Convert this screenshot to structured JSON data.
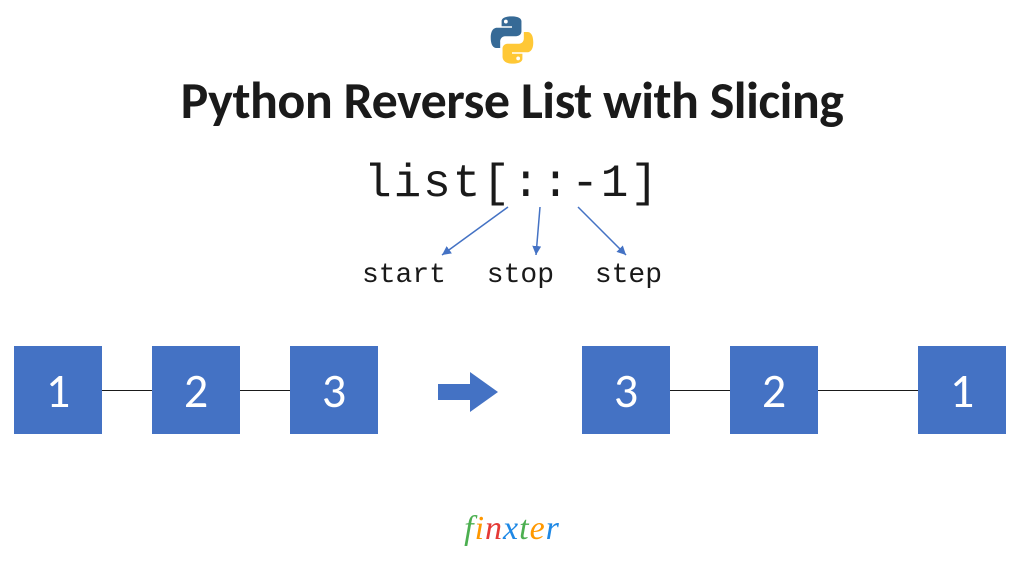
{
  "title": "Python Reverse List with Slicing",
  "code_expression": "list[::-1]",
  "slice_labels": {
    "start": "start",
    "stop": "stop",
    "step": "step"
  },
  "lists": {
    "original": [
      "1",
      "2",
      "3"
    ],
    "reversed": [
      "3",
      "2",
      "1"
    ]
  },
  "colors": {
    "node_fill": "#4472c4",
    "arrow_fill": "#4472c4",
    "annotation_arrow": "#4472c4",
    "text": "#1a1a1a"
  },
  "branding": {
    "name": "finxter",
    "letters": [
      {
        "ch": "f",
        "color": "#4caf50"
      },
      {
        "ch": "i",
        "color": "#ff9800"
      },
      {
        "ch": "n",
        "color": "#e53935"
      },
      {
        "ch": "x",
        "color": "#1e88e5"
      },
      {
        "ch": "t",
        "color": "#4caf50"
      },
      {
        "ch": "e",
        "color": "#ff9800"
      },
      {
        "ch": "r",
        "color": "#1e88e5"
      }
    ]
  },
  "logo": "python-logo"
}
